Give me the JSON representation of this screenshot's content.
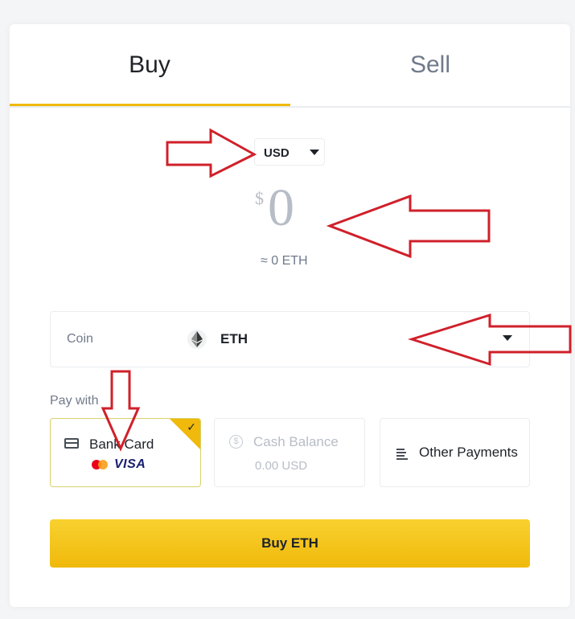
{
  "tabs": {
    "buy": "Buy",
    "sell": "Sell",
    "active": "buy"
  },
  "currency": {
    "selected": "USD"
  },
  "amount": {
    "symbol": "$",
    "value": "0",
    "converted": "≈ 0 ETH"
  },
  "coin": {
    "label": "Coin",
    "value": "ETH",
    "icon": "ethereum-icon"
  },
  "pay_with": {
    "label": "Pay with",
    "options": [
      {
        "label": "Bank Card",
        "icon": "bank-card-icon",
        "brands": [
          "mastercard",
          "VISA"
        ],
        "selected": true
      },
      {
        "label": "Cash Balance",
        "icon": "cash-balance-icon",
        "value": "0.00 USD",
        "disabled": true
      },
      {
        "label": "Other Payments",
        "icon": "list-icon"
      }
    ]
  },
  "cta": {
    "label": "Buy ETH"
  },
  "colors": {
    "accent": "#f0b90b",
    "annotation": "#d0202a",
    "text": "#1e2329",
    "muted": "#707a8a"
  }
}
